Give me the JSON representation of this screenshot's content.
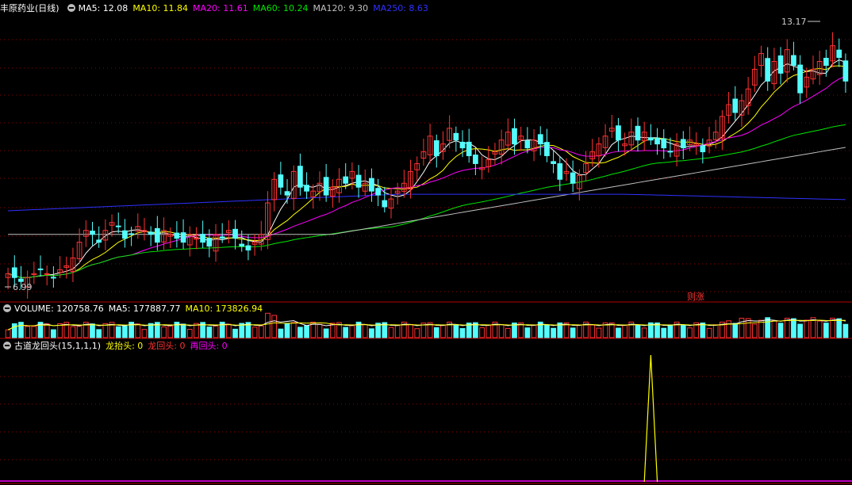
{
  "stock": {
    "name": "丰原药业(日线)"
  },
  "price_panel": {
    "ma5": "MA5: 12.08",
    "ma10": "MA10: 11.84",
    "ma20": "MA20: 11.61",
    "ma60": "MA60: 10.24",
    "ma120": "MA120: 9.30",
    "ma250": "MA250: 8.63",
    "high_label": "13.17",
    "low_label": "6.99",
    "event_label": "则涨"
  },
  "volume_panel": {
    "volume": "VOLUME: 120758.76",
    "ma5": "MA5: 177887.77",
    "ma10": "MA10: 173826.94"
  },
  "indicator_panel": {
    "name": "古道龙回头(15,1,1,1)",
    "long_raise": "龙抬头: 0",
    "long_back": "龙回头: 0",
    "again_back": "再回头: 0"
  },
  "colors": {
    "up": "#ff3232",
    "down": "#54fcfc",
    "ma5": "#ffffff",
    "ma10": "#ffff00",
    "ma20": "#ff00ff",
    "ma60": "#00e600",
    "ma120": "#c0c0c0",
    "ma250": "#3030ff",
    "grid": "#8b0000",
    "border": "#b40000"
  },
  "chart_data": {
    "type": "candlestick",
    "price_closes": [
      7.2,
      7.1,
      7.0,
      7.1,
      7.2,
      7.3,
      7.2,
      7.1,
      7.3,
      7.4,
      7.6,
      8.0,
      8.3,
      8.2,
      8.0,
      8.3,
      8.5,
      8.4,
      8.1,
      8.2,
      8.4,
      8.3,
      8.2,
      8.0,
      8.3,
      8.2,
      8.1,
      8.0,
      8.2,
      8.1,
      8.0,
      7.9,
      8.2,
      8.1,
      8.3,
      8.1,
      7.9,
      7.8,
      8.0,
      8.2,
      9.0,
      9.6,
      9.4,
      9.2,
      9.8,
      9.4,
      9.3,
      9.3,
      9.5,
      9.2,
      9.4,
      9.6,
      9.5,
      9.8,
      9.4,
      9.5,
      9.3,
      9.2,
      8.9,
      9.1,
      9.3,
      9.5,
      9.8,
      10.0,
      10.3,
      10.7,
      10.2,
      10.5,
      10.9,
      10.6,
      10.4,
      10.2,
      10.0,
      9.9,
      10.1,
      10.3,
      10.6,
      10.8,
      10.5,
      10.7,
      10.4,
      10.6,
      10.5,
      10.2,
      10.0,
      9.6,
      9.8,
      9.5,
      9.7,
      10.0,
      10.3,
      10.5,
      10.7,
      10.9,
      10.6,
      10.5,
      10.8,
      10.6,
      10.8,
      10.6,
      10.5,
      10.4,
      10.3,
      10.5,
      10.4,
      10.6,
      10.5,
      10.3,
      10.6,
      10.8,
      11.2,
      11.5,
      11.3,
      11.6,
      11.9,
      12.4,
      12.8,
      12.1,
      12.6,
      12.3,
      12.9,
      12.5,
      11.8,
      12.2,
      12.4,
      12.6,
      12.5,
      13.0,
      12.7,
      12.1
    ],
    "price_range": [
      6.5,
      13.8
    ],
    "labels": {
      "max": 13.17,
      "min": 6.99
    },
    "indicator_peak_index": 99
  }
}
